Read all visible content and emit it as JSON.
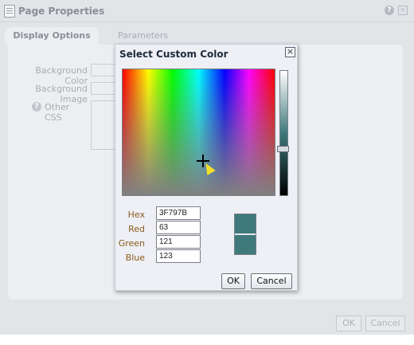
{
  "outer": {
    "title": "Page Properties",
    "help_glyph": "?",
    "close_glyph": "×",
    "tabs": [
      {
        "label": "Display Options",
        "active": true
      },
      {
        "label": "Parameters",
        "active": false
      }
    ],
    "fields": {
      "background_color_label": "Background Color",
      "background_image_label": "Background Image",
      "other_css_label": "Other CSS",
      "help_glyph": "?"
    },
    "footer": {
      "ok_label": "OK",
      "cancel_label": "Cancel"
    }
  },
  "modal": {
    "title": "Select Custom Color",
    "close_glyph": "×",
    "hex_label": "Hex",
    "hex_value": "3F797B",
    "red_label": "Red",
    "red_value": "63",
    "green_label": "Green",
    "green_value": "121",
    "blue_label": "Blue",
    "blue_value": "123",
    "ok_label": "OK",
    "cancel_label": "Cancel",
    "selected_color": "#3f797b"
  },
  "icons": {
    "outer_title_icon": "document-icon",
    "help": "help-icon",
    "close": "close-icon",
    "picker_cursor": "crosshair-icon"
  }
}
